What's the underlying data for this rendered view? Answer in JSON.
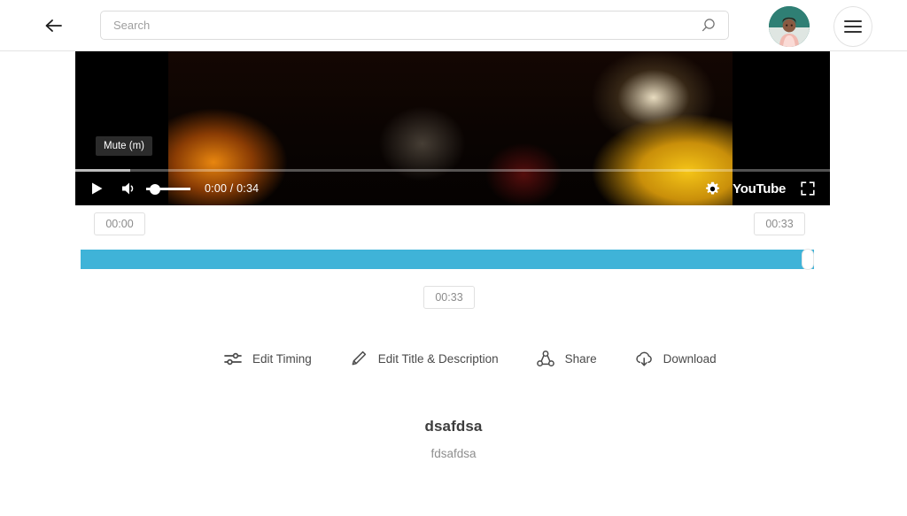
{
  "header": {
    "back_icon": "arrow-left-icon",
    "search": {
      "placeholder": "Search",
      "value": "",
      "icon": "search-icon"
    },
    "avatar_icon": "user-avatar",
    "menu_icon": "hamburger-menu-icon"
  },
  "player": {
    "play_icon": "play-icon",
    "volume_icon": "volume-icon",
    "time_display": "0:00 / 0:34",
    "current_time": "0:00",
    "duration": "0:34",
    "tooltip": "Mute (m)",
    "settings_icon": "gear-icon",
    "brand": "YouTube",
    "fullscreen_icon": "fullscreen-icon",
    "progress_percent": 0,
    "volume_percent": 10
  },
  "trim": {
    "start_time": "00:00",
    "end_time": "00:33",
    "duration": "00:33",
    "range_percent": 98,
    "fill_color": "#3fb3d8"
  },
  "actions": [
    {
      "label": "Edit Timing",
      "icon": "sliders-icon"
    },
    {
      "label": "Edit Title & Description",
      "icon": "pencil-icon"
    },
    {
      "label": "Share",
      "icon": "share-icon"
    },
    {
      "label": "Download",
      "icon": "cloud-download-icon"
    }
  ],
  "meta": {
    "title": "dsafdsa",
    "description": "fdsafdsa"
  }
}
